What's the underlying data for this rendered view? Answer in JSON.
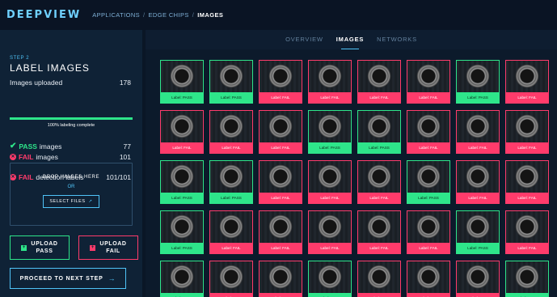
{
  "app": {
    "logo": "DEEPVIEW",
    "breadcrumb": [
      "APPLICATIONS",
      "EDGE CHIPS",
      "IMAGES"
    ]
  },
  "tabs": [
    {
      "label": "OVERVIEW",
      "active": false
    },
    {
      "label": "IMAGES",
      "active": true
    },
    {
      "label": "NETWORKS",
      "active": false
    }
  ],
  "sidebar": {
    "step": "STEP 2",
    "title": "LABEL IMAGES",
    "uploaded_label": "Images uploaded",
    "uploaded_count": "178",
    "labeling_progress": 1.0,
    "labeling_note": "100% labeling complete",
    "pass_word": "PASS",
    "pass_suffix": "images",
    "pass_count": "77",
    "fail_word": "FAIL",
    "fail_suffix": "images",
    "fail_count": "101",
    "detect_fail_word": "FAIL",
    "detect_suffix": "detection labels",
    "detect_count": "101/101",
    "drop_text": "DROP IMAGES HERE",
    "or_text": "OR",
    "select_files": "SELECT FILES",
    "upload_pass": [
      "UPLOAD",
      "PASS"
    ],
    "upload_fail": [
      "UPLOAD",
      "FAIL"
    ],
    "proceed": "PROCEED TO NEXT STEP"
  },
  "colors": {
    "pass": "#2ee58a",
    "fail": "#ff3b6b",
    "accent": "#4fc3f7"
  },
  "thumbnails": [
    [
      "Label: PASS",
      "Label: PASS",
      "Label: FAIL",
      "Label: FAIL",
      "Label: FAIL",
      "Label: FAIL",
      "Label: PASS",
      "Label: FAIL"
    ],
    [
      "Label: FAIL",
      "Label: FAIL",
      "Label: FAIL",
      "Label: PASS",
      "Label: PASS",
      "Label: FAIL",
      "Label: FAIL",
      "Label: FAIL"
    ],
    [
      "Label: PASS",
      "Label: PASS",
      "Label: FAIL",
      "Label: FAIL",
      "Label: FAIL",
      "Label: PASS",
      "Label: FAIL",
      "Label: FAIL"
    ],
    [
      "Label: PASS",
      "Label: FAIL",
      "Label: FAIL",
      "Label: FAIL",
      "Label: FAIL",
      "Label: FAIL",
      "Label: PASS",
      "Label: FAIL"
    ],
    [
      "Label: PASS",
      "Label: FAIL",
      "Label: FAIL",
      "Label: PASS",
      "Label: FAIL",
      "Label: FAIL",
      "Label: FAIL",
      "Label: PASS"
    ]
  ]
}
